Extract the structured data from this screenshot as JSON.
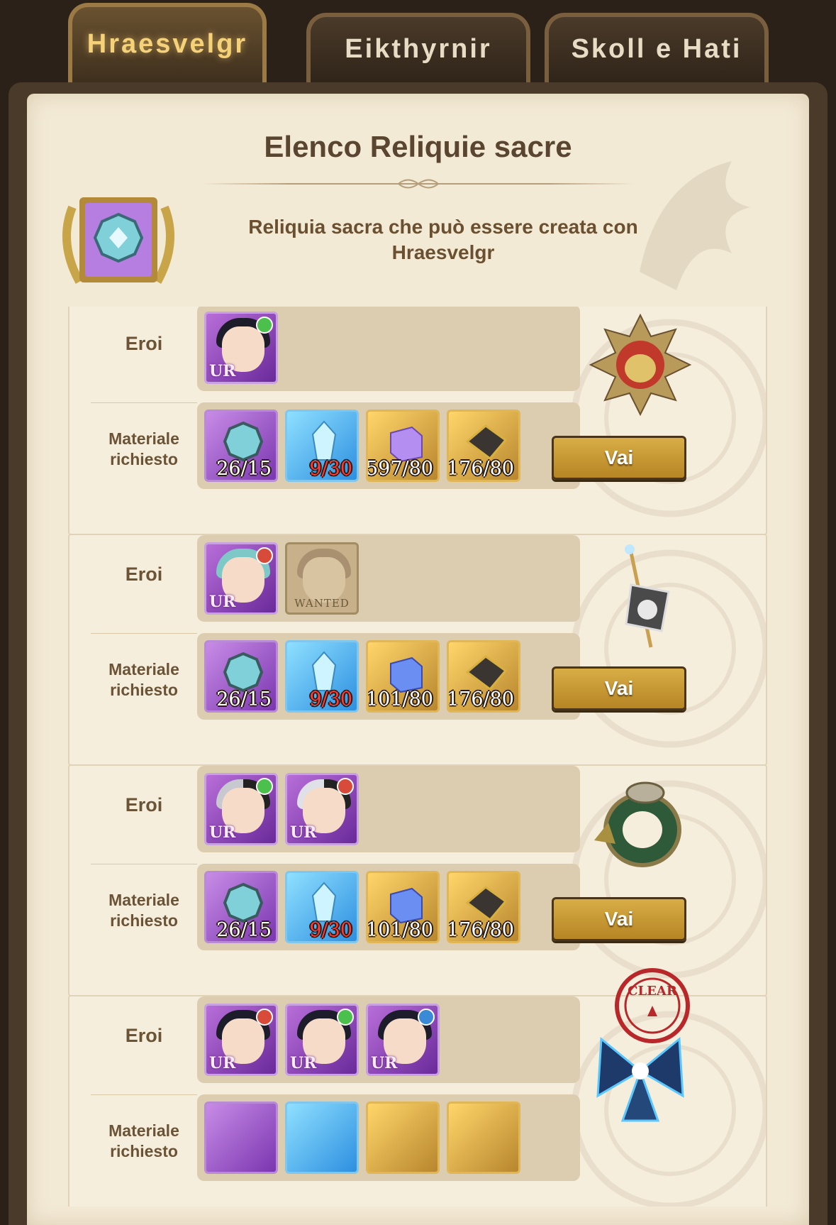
{
  "tabs": [
    {
      "label": "Hraesvelgr",
      "active": true
    },
    {
      "label": "Eikthyrnir",
      "active": false
    },
    {
      "label": "Skoll e Hati",
      "active": false
    }
  ],
  "header": {
    "title": "Elenco Reliquie sacre",
    "description": "Reliquia sacra che può essere creata con Hraesvelgr"
  },
  "labels": {
    "heroes": "Eroi",
    "materials": "Materiale richiesto",
    "go_button": "Vai",
    "wanted": "WANTED",
    "ur": "UR",
    "clear_stamp": "CLEAR"
  },
  "relics": [
    {
      "heroes": [
        {
          "type": "ur",
          "attribute": "green",
          "hair": "dark"
        }
      ],
      "materials": [
        {
          "type": "emblem",
          "count": "26/15",
          "insufficient": false
        },
        {
          "type": "crystal",
          "count": "9/30",
          "insufficient": true
        },
        {
          "type": "cube-purple",
          "count": "597/80",
          "insufficient": false
        },
        {
          "type": "ore",
          "count": "176/80",
          "insufficient": false
        }
      ],
      "relic_icon": "sun-amulet-icon",
      "action": "Vai"
    },
    {
      "heroes": [
        {
          "type": "ur",
          "attribute": "red",
          "hair": "teal"
        },
        {
          "type": "wanted"
        }
      ],
      "materials": [
        {
          "type": "emblem",
          "count": "26/15",
          "insufficient": false
        },
        {
          "type": "crystal",
          "count": "9/30",
          "insufficient": true
        },
        {
          "type": "cube-blue",
          "count": "101/80",
          "insufficient": false
        },
        {
          "type": "ore",
          "count": "176/80",
          "insufficient": false
        }
      ],
      "relic_icon": "staff-banner-icon",
      "action": "Vai"
    },
    {
      "heroes": [
        {
          "type": "ur",
          "attribute": "green",
          "hair": "silver"
        },
        {
          "type": "ur",
          "attribute": "red",
          "hair": "silver"
        }
      ],
      "materials": [
        {
          "type": "emblem",
          "count": "26/15",
          "insufficient": false
        },
        {
          "type": "crystal",
          "count": "9/30",
          "insufficient": true
        },
        {
          "type": "cube-blue",
          "count": "101/80",
          "insufficient": false
        },
        {
          "type": "ore",
          "count": "176/80",
          "insufficient": false
        }
      ],
      "relic_icon": "dragon-ring-icon",
      "action": "Vai"
    },
    {
      "heroes": [
        {
          "type": "ur",
          "attribute": "red",
          "hair": "dark"
        },
        {
          "type": "ur",
          "attribute": "green",
          "hair": "dark"
        },
        {
          "type": "ur",
          "attribute": "blue",
          "hair": "dark"
        }
      ],
      "materials": [],
      "relic_icon": "crystal-ribbon-icon",
      "action": null,
      "cleared": true
    }
  ],
  "colors": {
    "accent_gold": "#f5d27a",
    "insufficient": "#ff3a3a",
    "paper": "#f3ead6",
    "ur_frame": "#b86ed9"
  }
}
